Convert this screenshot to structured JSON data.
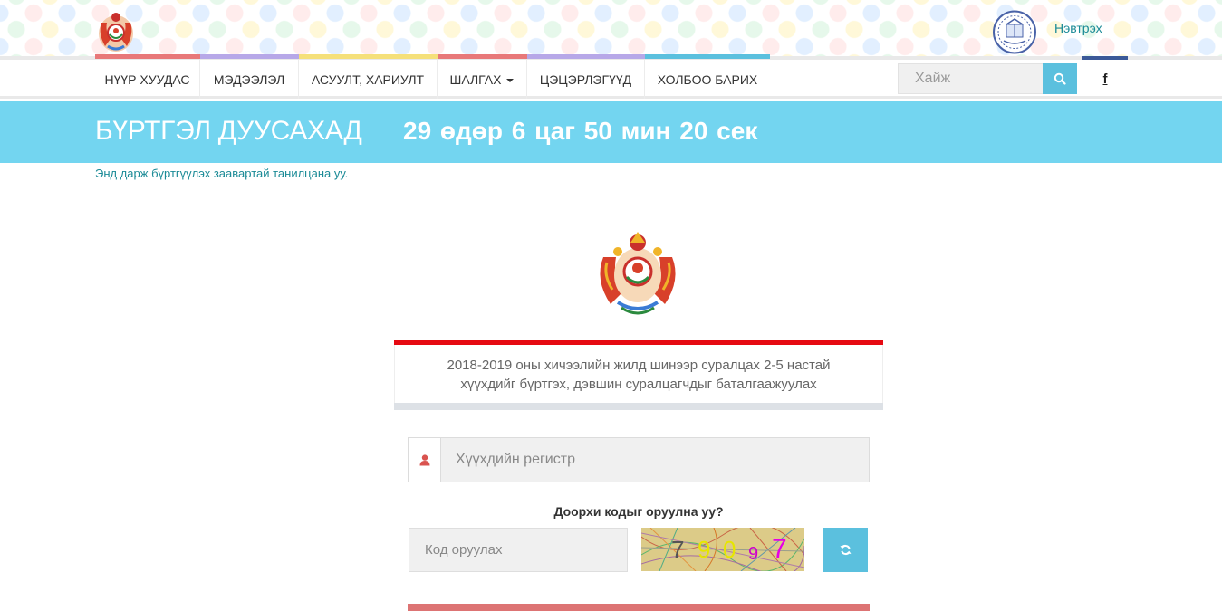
{
  "header": {
    "login_label": "Нэвтрэх"
  },
  "nav": {
    "items": [
      {
        "label": "НҮҮР ХУУДАС",
        "accent": "#e87879"
      },
      {
        "label": "МЭДЭЭЛЭЛ",
        "accent": "#b7a8e8"
      },
      {
        "label": "АСУУЛТ, ХАРИУЛТ",
        "accent": "#f5e07a"
      },
      {
        "label": "ШАЛГАХ",
        "accent": "#e87879",
        "dropdown": true
      },
      {
        "label": "ЦЭЦЭРЛЭГҮҮД",
        "accent": "#b7a8e8"
      },
      {
        "label": "ХОЛБОО БАРИХ",
        "accent": "#5bc0de"
      }
    ],
    "search_placeholder": "Хайж",
    "facebook_glyph": "f"
  },
  "countdown": {
    "label": "БҮРТГЭЛ ДУУСАХАД",
    "value": "29 өдөр 6 цаг 50 мин 20 сек",
    "bg_color": "#73d5f0"
  },
  "instructions_link": "Энд дарж бүртгүүлэх заавартай танилцана уу.",
  "card": {
    "title_line1": "2018-2019 оны хичээлийн жилд шинээр суралцах 2-5 настай",
    "title_line2": "хүүхдийг бүртгэх, дэвшин суралцагчдыг баталгаажуулах",
    "accent_color": "#e60a12"
  },
  "form": {
    "registry_placeholder": "Хүүхдийн регистр",
    "captcha_question": "Доорхи кодыг оруулна уу?",
    "code_placeholder": "Код оруулах",
    "captcha_chars": [
      "7",
      "9",
      "0",
      "9",
      "7"
    ]
  },
  "icons": {
    "search": "search-icon",
    "user": "user-icon",
    "refresh": "refresh-icon",
    "facebook": "facebook-icon"
  }
}
